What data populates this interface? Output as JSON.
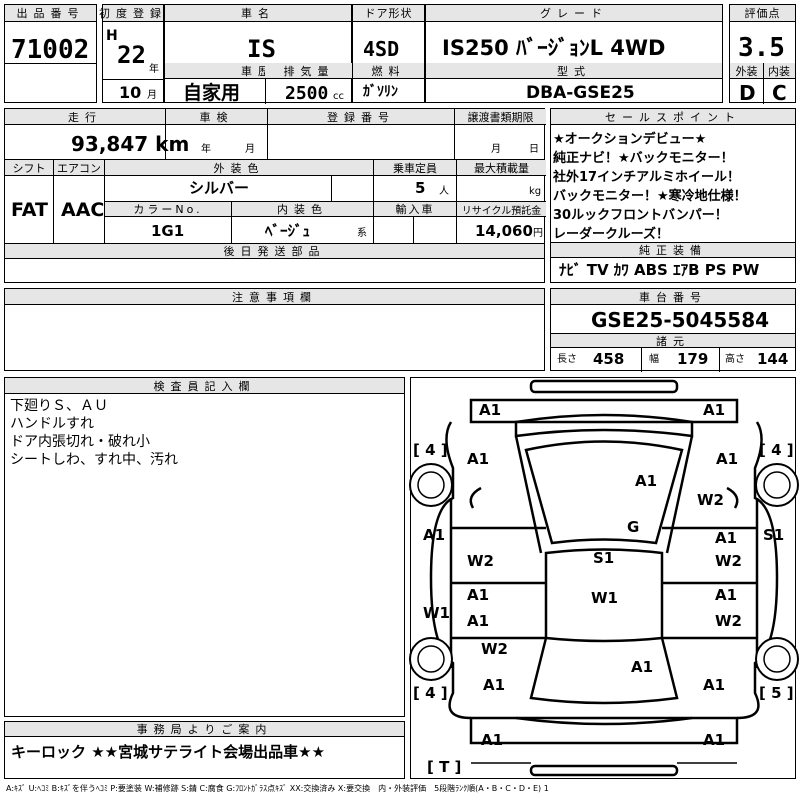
{
  "header": {
    "lot_label": "出品番号",
    "lot": "71002",
    "reg_label": "初度登録",
    "era": "H",
    "year": "22",
    "year_unit": "年",
    "month": "10",
    "month_unit": "月",
    "history_label": "車歴",
    "history": "自家用",
    "name_label": "車名",
    "name": "IS",
    "disp_label": "排気量",
    "disp": "2500",
    "disp_unit": "cc",
    "door_label": "ドア形状",
    "door": "4SD",
    "fuel_label": "燃料",
    "fuel": "ｶﾞｿﾘﾝ",
    "grade_label": "グレード",
    "grade": "IS250 ﾊﾞｰｼﾞｮﾝL 4WD",
    "model_label": "型式",
    "model": "DBA-GSE25",
    "score_label": "評価点",
    "score": "3.5",
    "ext_label": "外装",
    "ext": "D",
    "int_label": "内装",
    "int": "C"
  },
  "row2": {
    "mileage_label": "走行",
    "mileage": "93,847 km",
    "inspect_label": "車検",
    "inspect_year": "年",
    "inspect_month": "月",
    "plate_label": "登録番号",
    "transfer_label": "譲渡書類期限",
    "transfer_month": "月",
    "transfer_day": "日",
    "shift_label": "シフト",
    "shift": "FAT",
    "ac_label": "エアコン",
    "ac": "AAC",
    "color_label": "外装色",
    "color": "シルバー",
    "cap_label": "乗車定員",
    "cap": "5",
    "cap_unit": "人",
    "load_label": "最大積載量",
    "load_unit": "kg",
    "colorno_label": "カラーNo.",
    "colorno": "1G1",
    "intcolor_label": "内装色",
    "intcolor": "ﾍﾞｰｼﾞｭ",
    "intcolor_unit": "系",
    "import_label": "輸入車",
    "recycle_label": "リサイクル預託金",
    "recycle": "14,060",
    "recycle_unit": "円",
    "later_label": "後日発送部品"
  },
  "selling": {
    "label": "セールスポイント",
    "lines": [
      "★オークションデビュー★",
      "純正ナビ！★バックモニター！",
      "社外17インチアルミホイール！",
      "バックモニター！★寒冷地仕様！",
      "30ルックフロントバンパー！",
      "レーダークルーズ！"
    ]
  },
  "equipment": {
    "label": "純正装備",
    "items": "ﾅﾋﾞ TV ｶﾜ ABS ｴｱB PS PW"
  },
  "notes": {
    "label": "注意事項欄"
  },
  "chassis": {
    "label": "車台番号",
    "value": "GSE25-5045584",
    "spec_label": "諸元",
    "len_label": "長さ",
    "len": "458",
    "wid_label": "幅",
    "wid": "179",
    "hgt_label": "高さ",
    "hgt": "144"
  },
  "inspector": {
    "label": "検査員記入欄",
    "lines": [
      "下廻りＳ、ＡＵ",
      "ハンドルすれ",
      "ドア内張切れ・破れ小",
      "シートしわ、すれ中、汚れ"
    ]
  },
  "diagram": {
    "fl_tire": "[ 4 ]",
    "fr_tire": "[ 4 ]",
    "rl_tire": "[ 4 ]",
    "rr_tire": "[ 5 ]",
    "spare": "[ T ]",
    "marks": [
      "A1",
      "A1",
      "A1",
      "A1",
      "A1",
      "W2",
      "G",
      "A1",
      "S1",
      "A1",
      "W2",
      "S1",
      "W2",
      "A1",
      "A1",
      "W1",
      "W1",
      "A1",
      "W2",
      "W2",
      "A1",
      "A1",
      "A1",
      "A1",
      "A1"
    ]
  },
  "office": {
    "label": "事務局よりご案内",
    "text": "キーロック ★★宮城サテライト会場出品車★★"
  },
  "legend": "A:ｷｽﾞ U:ﾍｺﾐ B:ｷｽﾞを伴うﾍｺﾐ P:要塗装 W:補修跡 S:錆 C:腐食 G:ﾌﾛﾝﾄｶﾞﾗｽ点ｷｽﾞ XX:交換済み X:要交換　内・外装評価　5段階ﾗﾝｸ順(A・B・C・D・E) 1"
}
